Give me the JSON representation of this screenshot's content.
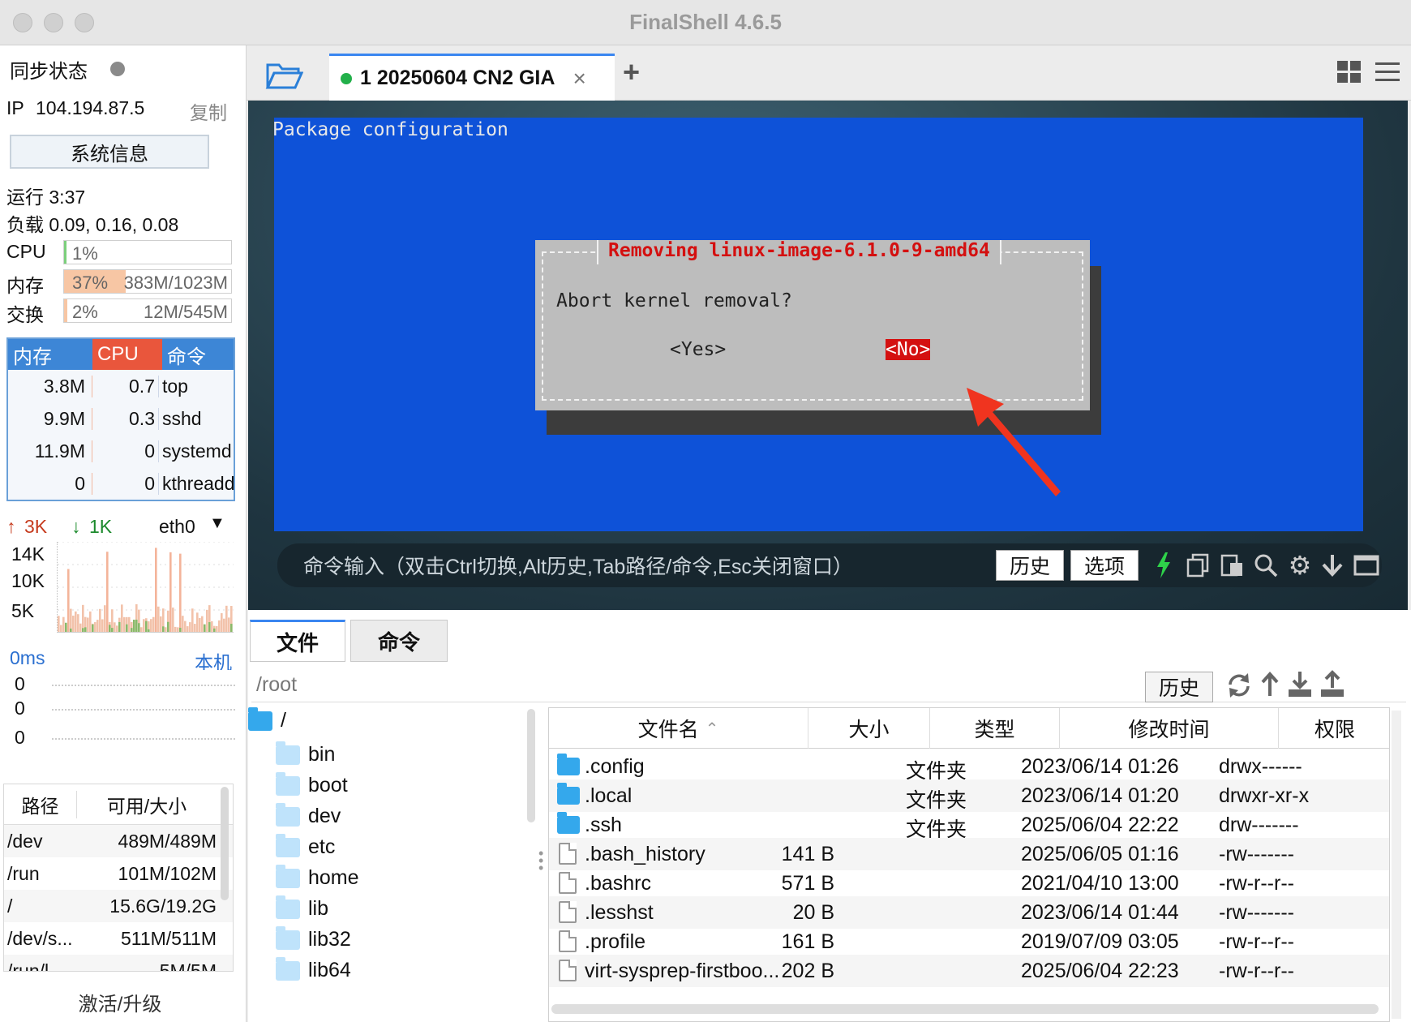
{
  "window": {
    "title": "FinalShell 4.6.5"
  },
  "sidebar": {
    "sync_label": "同步状态",
    "ip_label": "IP",
    "ip_value": "104.194.87.5",
    "copy_label": "复制",
    "sysinfo_button": "系统信息",
    "uptime": "运行 3:37",
    "load": "负载 0.09, 0.16, 0.08",
    "meters": [
      {
        "label": "CPU",
        "percent_text": "1%",
        "extra": "",
        "fraction": 0.01,
        "color": "#7ccf7c"
      },
      {
        "label": "内存",
        "percent_text": "37%",
        "extra": "383M/1023M",
        "fraction": 0.37,
        "color": "#f7c6a4"
      },
      {
        "label": "交换",
        "percent_text": "2%",
        "extra": "12M/545M",
        "fraction": 0.02,
        "color": "#f7c6a4"
      }
    ],
    "proc_headers": [
      "内存",
      "CPU",
      "命令"
    ],
    "processes": [
      {
        "mem": "3.8M",
        "cpu": "0.7",
        "cmd": "top"
      },
      {
        "mem": "9.9M",
        "cpu": "0.3",
        "cmd": "sshd"
      },
      {
        "mem": "11.9M",
        "cpu": "0",
        "cmd": "systemd"
      },
      {
        "mem": "0",
        "cpu": "0",
        "cmd": "kthreadd"
      }
    ],
    "net": {
      "up": "3K",
      "down": "1K",
      "iface": "eth0",
      "y_ticks": [
        "14K",
        "10K",
        "5K"
      ]
    },
    "latency": {
      "ms": "0ms",
      "host": "本机",
      "values": [
        "0",
        "0",
        "0"
      ]
    },
    "disk_headers": [
      "路径",
      "可用/大小"
    ],
    "disks": [
      {
        "path": "/dev",
        "size": "489M/489M"
      },
      {
        "path": "/run",
        "size": "101M/102M"
      },
      {
        "path": "/",
        "size": "15.6G/19.2G"
      },
      {
        "path": "/dev/s...",
        "size": "511M/511M"
      },
      {
        "path": "/run/l...",
        "size": "5M/5M"
      }
    ],
    "activate": "激活/升级"
  },
  "tabs": {
    "active_label": "1 20250604 CN2 GIA",
    "close": "×",
    "add": "+"
  },
  "terminal": {
    "header": "Package configuration",
    "dialog_title": "Removing linux-image-6.1.0-9-amd64",
    "dialog_question": "Abort kernel removal?",
    "yes_label": "<Yes>",
    "no_label": "<No>"
  },
  "cmdbar": {
    "placeholder": "命令输入（双击Ctrl切换,Alt历史,Tab路径/命令,Esc关闭窗口）",
    "history": "历史",
    "options": "选项"
  },
  "bottom": {
    "tabs": [
      "文件",
      "命令"
    ],
    "path": "/root",
    "history": "历史",
    "tree": [
      {
        "name": "/",
        "root": true
      },
      {
        "name": "bin"
      },
      {
        "name": "boot"
      },
      {
        "name": "dev"
      },
      {
        "name": "etc"
      },
      {
        "name": "home"
      },
      {
        "name": "lib"
      },
      {
        "name": "lib32"
      },
      {
        "name": "lib64"
      }
    ],
    "file_headers": [
      "文件名",
      "大小",
      "类型",
      "修改时间",
      "权限"
    ],
    "files": [
      {
        "name": ".config",
        "size": "",
        "type": "文件夹",
        "mtime": "2023/06/14 01:26",
        "perm": "drwx------",
        "folder": true
      },
      {
        "name": ".local",
        "size": "",
        "type": "文件夹",
        "mtime": "2023/06/14 01:20",
        "perm": "drwxr-xr-x",
        "folder": true
      },
      {
        "name": ".ssh",
        "size": "",
        "type": "文件夹",
        "mtime": "2025/06/04 22:22",
        "perm": "drw-------",
        "folder": true
      },
      {
        "name": ".bash_history",
        "size": "141 B",
        "type": "",
        "mtime": "2025/06/05 01:16",
        "perm": "-rw-------",
        "folder": false
      },
      {
        "name": ".bashrc",
        "size": "571 B",
        "type": "",
        "mtime": "2021/04/10 13:00",
        "perm": "-rw-r--r--",
        "folder": false
      },
      {
        "name": ".lesshst",
        "size": "20 B",
        "type": "",
        "mtime": "2023/06/14 01:44",
        "perm": "-rw-------",
        "folder": false
      },
      {
        "name": ".profile",
        "size": "161 B",
        "type": "",
        "mtime": "2019/07/09 03:05",
        "perm": "-rw-r--r--",
        "folder": false
      },
      {
        "name": "virt-sysprep-firstboo...",
        "size": "202 B",
        "type": "",
        "mtime": "2025/06/04 22:23",
        "perm": "-rw-r--r--",
        "folder": false
      }
    ]
  }
}
